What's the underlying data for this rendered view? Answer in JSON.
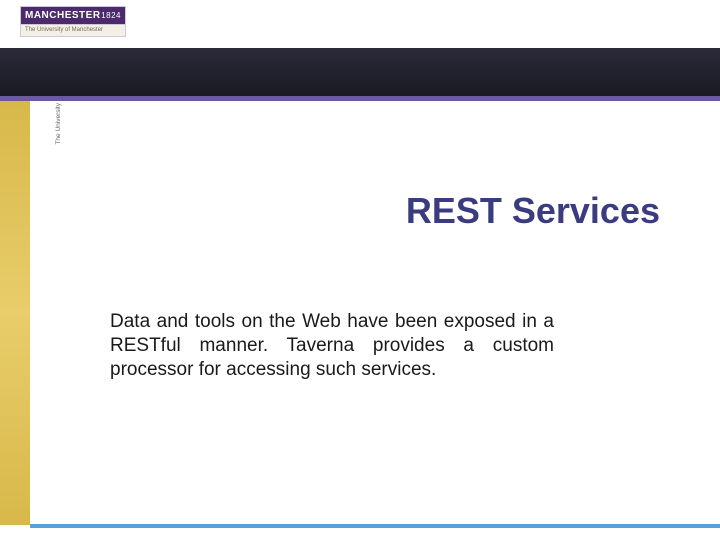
{
  "logo": {
    "name": "MANCHESTER",
    "year": "1824",
    "subtitle": "The University of Manchester",
    "vertical": "The University\nof Manchester"
  },
  "title": "REST Services",
  "body": "Data and tools on the Web have been exposed in a RESTful manner. Taverna provides a custom processor for accessing such services."
}
